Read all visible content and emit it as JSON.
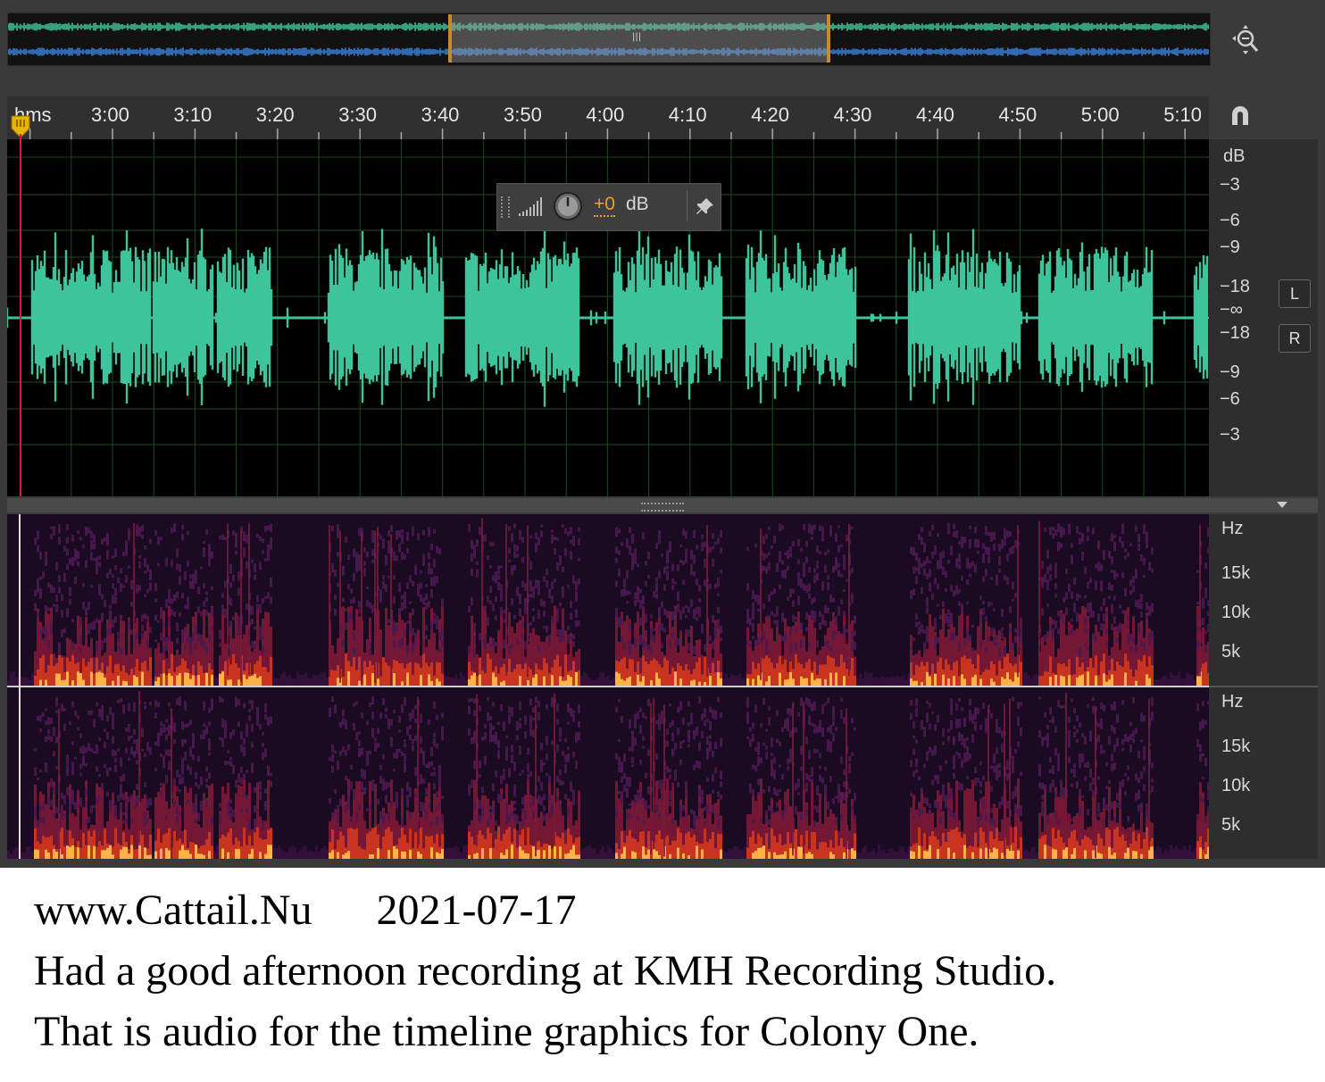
{
  "overview": {
    "zoom_icon": "zoom-icon",
    "handle_glyph": "|||"
  },
  "ruler": {
    "format_label": "hms",
    "ticks": [
      "3:00",
      "3:10",
      "3:20",
      "3:30",
      "3:40",
      "3:50",
      "4:00",
      "4:10",
      "4:20",
      "4:30",
      "4:40",
      "4:50",
      "5:00",
      "5:10"
    ],
    "snap_icon": "magnet-icon"
  },
  "db_scale": {
    "unit": "dB",
    "labels": [
      "−3",
      "−6",
      "−9",
      "−18",
      "−∞",
      "−18",
      "−9",
      "−6",
      "−3"
    ]
  },
  "channels": {
    "left": "L",
    "right": "R"
  },
  "hud": {
    "gain": "+0",
    "unit": "dB"
  },
  "spectral_top": {
    "unit": "Hz",
    "labels": [
      "15k",
      "10k",
      "5k"
    ]
  },
  "spectral_bottom": {
    "unit": "Hz",
    "labels": [
      "15k",
      "10k",
      "5k"
    ]
  },
  "colors": {
    "waveform": "#3ec49a",
    "overview_top": "#3ec49a",
    "overview_bottom": "#3b7fd6",
    "playhead": "#d42020",
    "grid": "#1e4a1e"
  },
  "caption": {
    "site": "www.Cattail.Nu",
    "date": "2021-07-17",
    "line2": "Had a good afternoon recording at KMH Recording Studio.",
    "line3": "That is audio for the timeline graphics for Colony One."
  }
}
